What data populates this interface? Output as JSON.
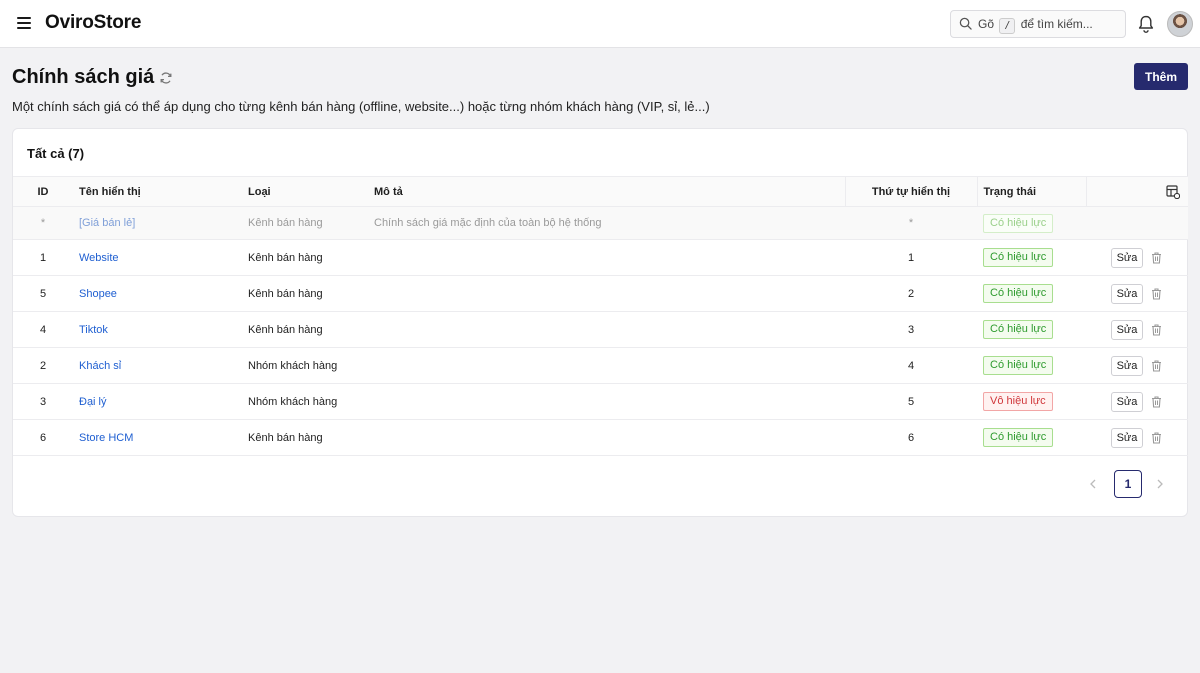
{
  "app": {
    "brand": "OviroStore"
  },
  "search": {
    "prefix": "Gõ",
    "key": "/",
    "suffix": "để tìm kiếm..."
  },
  "page": {
    "title": "Chính sách giá",
    "subtitle": "Một chính sách giá có thể áp dụng cho từng kênh bán hàng (offline, website...) hoặc từng nhóm khách hàng (VIP, sỉ, lẻ...)",
    "add_label": "Thêm"
  },
  "card": {
    "tab_label": "Tất cả (7)"
  },
  "table": {
    "headers": {
      "id": "ID",
      "name": "Tên hiển thị",
      "type": "Loại",
      "desc": "Mô tả",
      "order": "Thứ tự hiển thị",
      "status": "Trạng thái"
    },
    "default_row": {
      "id": "*",
      "name": "[Giá bán lẻ]",
      "type": "Kênh bán hàng",
      "desc": "Chính sách giá mặc định của toàn bộ hệ thống",
      "order": "*",
      "status": "Có hiệu lực"
    },
    "rows": [
      {
        "id": "1",
        "name": "Website",
        "type": "Kênh bán hàng",
        "desc": "",
        "order": "1",
        "status": "Có hiệu lực"
      },
      {
        "id": "5",
        "name": "Shopee",
        "type": "Kênh bán hàng",
        "desc": "",
        "order": "2",
        "status": "Có hiệu lực"
      },
      {
        "id": "4",
        "name": "Tiktok",
        "type": "Kênh bán hàng",
        "desc": "",
        "order": "3",
        "status": "Có hiệu lực"
      },
      {
        "id": "2",
        "name": "Khách sỉ",
        "type": "Nhóm khách hàng",
        "desc": "",
        "order": "4",
        "status": "Có hiệu lực"
      },
      {
        "id": "3",
        "name": "Đại lý",
        "type": "Nhóm khách hàng",
        "desc": "",
        "order": "5",
        "status": "Vô hiệu lực"
      },
      {
        "id": "6",
        "name": "Store HCM",
        "type": "Kênh bán hàng",
        "desc": "",
        "order": "6",
        "status": "Có hiệu lực"
      }
    ],
    "edit_label": "Sửa"
  },
  "pagination": {
    "current": "1"
  },
  "colors": {
    "primary": "#262a6e",
    "link": "#1f5fd1",
    "active": "#2e9b2e",
    "inactive": "#d0363a"
  }
}
